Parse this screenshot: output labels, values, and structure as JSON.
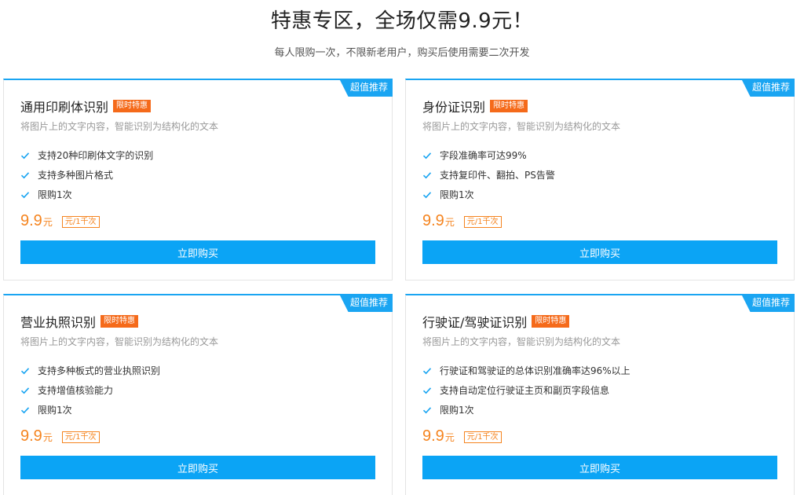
{
  "hero": {
    "title": "特惠专区，全场仅需9.9元！",
    "subtitle": "每人限购一次，不限新老用户，购买后使用需要二次开发"
  },
  "colors": {
    "accent": "#1aa5f2",
    "button": "#0ba4f5",
    "price": "#f5841f",
    "tag": "#f56a1a"
  },
  "cards": [
    {
      "badge": "超值推荐",
      "title": "通用印刷体识别",
      "tag": "限时特惠",
      "desc": "将图片上的文字内容，智能识别为结构化的文本",
      "features": [
        "支持20种印刷体文字的识别",
        "支持多种图片格式",
        "限购1次"
      ],
      "price": "9.9",
      "price_unit": "元",
      "price_tag": "元/1千次",
      "button": "立即购买"
    },
    {
      "badge": "超值推荐",
      "title": "身份证识别",
      "tag": "限时特惠",
      "desc": "将图片上的文字内容，智能识别为结构化的文本",
      "features": [
        "字段准确率可达99%",
        "支持复印件、翻拍、PS告警",
        "限购1次"
      ],
      "price": "9.9",
      "price_unit": "元",
      "price_tag": "元/1千次",
      "button": "立即购买"
    },
    {
      "badge": "超值推荐",
      "title": "营业执照识别",
      "tag": "限时特惠",
      "desc": "将图片上的文字内容，智能识别为结构化的文本",
      "features": [
        "支持多种板式的营业执照识别",
        "支持增值核验能力",
        "限购1次"
      ],
      "price": "9.9",
      "price_unit": "元",
      "price_tag": "元/1千次",
      "button": "立即购买"
    },
    {
      "badge": "超值推荐",
      "title": "行驶证/驾驶证识别",
      "tag": "限时特惠",
      "desc": "将图片上的文字内容，智能识别为结构化的文本",
      "features": [
        "行驶证和驾驶证的总体识别准确率达96%以上",
        "支持自动定位行驶证主页和副页字段信息",
        "限购1次"
      ],
      "price": "9.9",
      "price_unit": "元",
      "price_tag": "元/1千次",
      "button": "立即购买"
    }
  ]
}
